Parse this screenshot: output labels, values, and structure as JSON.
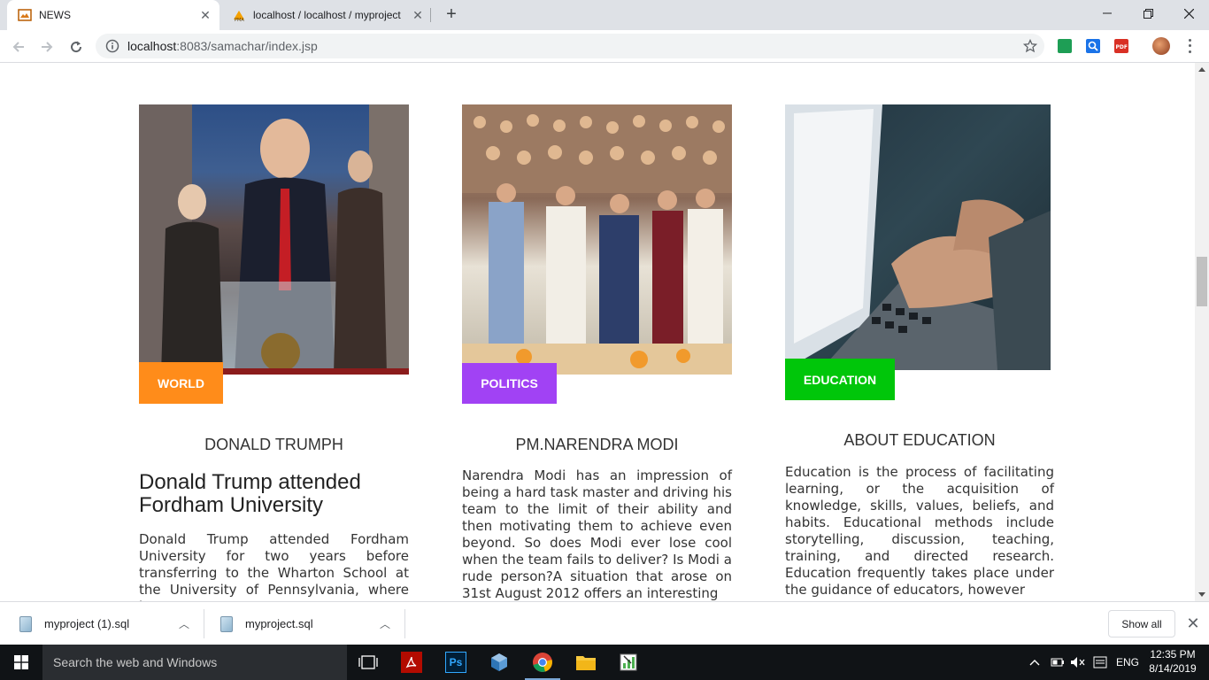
{
  "browser": {
    "tabs": [
      {
        "title": "NEWS",
        "active": true
      },
      {
        "title": "localhost / localhost / myproject",
        "active": false
      }
    ],
    "url_host": "localhost",
    "url_rest": ":8083/samachar/index.jsp"
  },
  "cards": [
    {
      "badge": "WORLD",
      "badge_color": "#ff8c1a",
      "heading": "DONALD TRUMPH",
      "subheading": "Donald Trump attended Fordham University",
      "text": "Donald Trump attended Fordham University for two years before transferring to the Wharton School at the University of Pennsylvania, where he"
    },
    {
      "badge": "POLITICS",
      "badge_color": "#a142f4",
      "heading": "PM.NARENDRA MODI",
      "text": "Narendra Modi has an impression of being a hard task master and driving his team to the limit of their ability and then motivating them to achieve even beyond. So does Modi ever lose cool when the team fails to deliver? Is Modi a rude person?A situation that arose on 31st August 2012 offers an interesting"
    },
    {
      "badge": "EDUCATION",
      "badge_color": "#00c60a",
      "heading": "ABOUT EDUCATION",
      "text": "Education is the process of facilitating learning, or the acquisition of knowledge, skills, values, beliefs, and habits. Educational methods include storytelling, discussion, teaching, training, and directed research. Education frequently takes place under the guidance of educators, however"
    }
  ],
  "downloads": {
    "items": [
      "myproject (1).sql",
      "myproject.sql"
    ],
    "show_all": "Show all"
  },
  "taskbar": {
    "search_placeholder": "Search the web and Windows",
    "language": "ENG",
    "time": "12:35 PM",
    "date": "8/14/2019"
  }
}
